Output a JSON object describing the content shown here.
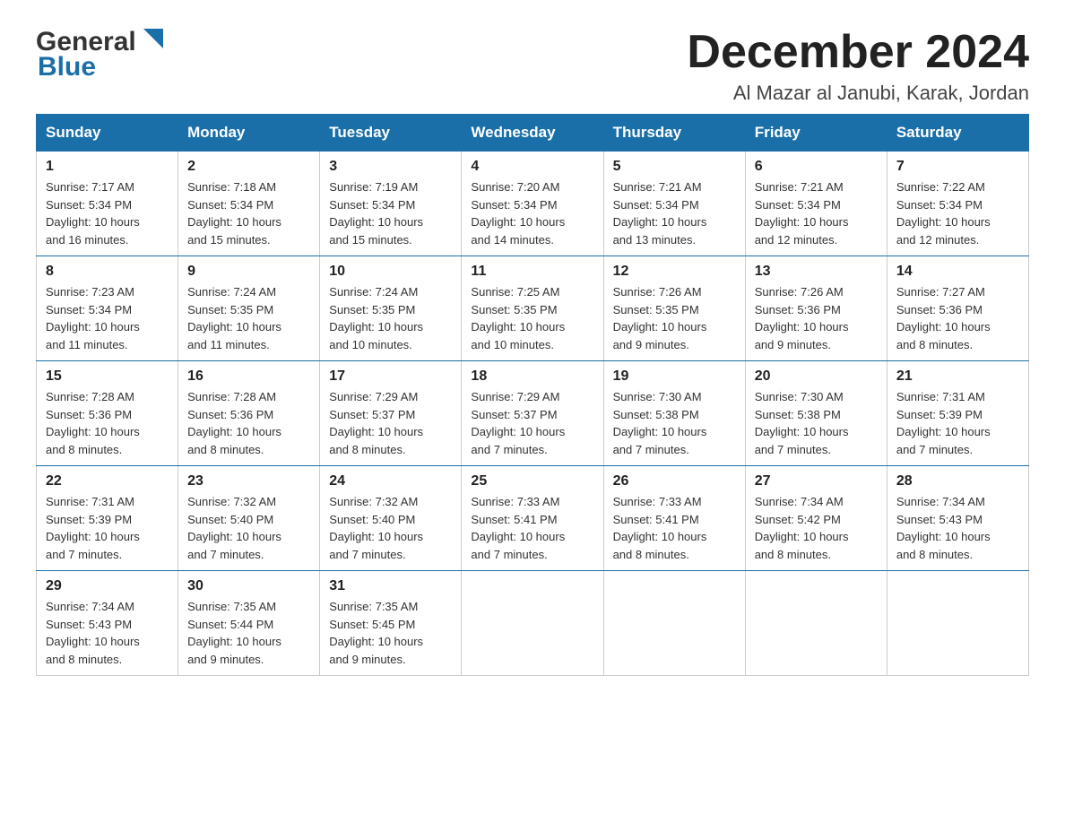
{
  "header": {
    "logo_general": "General",
    "logo_blue": "Blue",
    "month_title": "December 2024",
    "location": "Al Mazar al Janubi, Karak, Jordan"
  },
  "days_of_week": [
    "Sunday",
    "Monday",
    "Tuesday",
    "Wednesday",
    "Thursday",
    "Friday",
    "Saturday"
  ],
  "weeks": [
    [
      {
        "day": "1",
        "sunrise": "7:17 AM",
        "sunset": "5:34 PM",
        "daylight": "10 hours and 16 minutes."
      },
      {
        "day": "2",
        "sunrise": "7:18 AM",
        "sunset": "5:34 PM",
        "daylight": "10 hours and 15 minutes."
      },
      {
        "day": "3",
        "sunrise": "7:19 AM",
        "sunset": "5:34 PM",
        "daylight": "10 hours and 15 minutes."
      },
      {
        "day": "4",
        "sunrise": "7:20 AM",
        "sunset": "5:34 PM",
        "daylight": "10 hours and 14 minutes."
      },
      {
        "day": "5",
        "sunrise": "7:21 AM",
        "sunset": "5:34 PM",
        "daylight": "10 hours and 13 minutes."
      },
      {
        "day": "6",
        "sunrise": "7:21 AM",
        "sunset": "5:34 PM",
        "daylight": "10 hours and 12 minutes."
      },
      {
        "day": "7",
        "sunrise": "7:22 AM",
        "sunset": "5:34 PM",
        "daylight": "10 hours and 12 minutes."
      }
    ],
    [
      {
        "day": "8",
        "sunrise": "7:23 AM",
        "sunset": "5:34 PM",
        "daylight": "10 hours and 11 minutes."
      },
      {
        "day": "9",
        "sunrise": "7:24 AM",
        "sunset": "5:35 PM",
        "daylight": "10 hours and 11 minutes."
      },
      {
        "day": "10",
        "sunrise": "7:24 AM",
        "sunset": "5:35 PM",
        "daylight": "10 hours and 10 minutes."
      },
      {
        "day": "11",
        "sunrise": "7:25 AM",
        "sunset": "5:35 PM",
        "daylight": "10 hours and 10 minutes."
      },
      {
        "day": "12",
        "sunrise": "7:26 AM",
        "sunset": "5:35 PM",
        "daylight": "10 hours and 9 minutes."
      },
      {
        "day": "13",
        "sunrise": "7:26 AM",
        "sunset": "5:36 PM",
        "daylight": "10 hours and 9 minutes."
      },
      {
        "day": "14",
        "sunrise": "7:27 AM",
        "sunset": "5:36 PM",
        "daylight": "10 hours and 8 minutes."
      }
    ],
    [
      {
        "day": "15",
        "sunrise": "7:28 AM",
        "sunset": "5:36 PM",
        "daylight": "10 hours and 8 minutes."
      },
      {
        "day": "16",
        "sunrise": "7:28 AM",
        "sunset": "5:36 PM",
        "daylight": "10 hours and 8 minutes."
      },
      {
        "day": "17",
        "sunrise": "7:29 AM",
        "sunset": "5:37 PM",
        "daylight": "10 hours and 8 minutes."
      },
      {
        "day": "18",
        "sunrise": "7:29 AM",
        "sunset": "5:37 PM",
        "daylight": "10 hours and 7 minutes."
      },
      {
        "day": "19",
        "sunrise": "7:30 AM",
        "sunset": "5:38 PM",
        "daylight": "10 hours and 7 minutes."
      },
      {
        "day": "20",
        "sunrise": "7:30 AM",
        "sunset": "5:38 PM",
        "daylight": "10 hours and 7 minutes."
      },
      {
        "day": "21",
        "sunrise": "7:31 AM",
        "sunset": "5:39 PM",
        "daylight": "10 hours and 7 minutes."
      }
    ],
    [
      {
        "day": "22",
        "sunrise": "7:31 AM",
        "sunset": "5:39 PM",
        "daylight": "10 hours and 7 minutes."
      },
      {
        "day": "23",
        "sunrise": "7:32 AM",
        "sunset": "5:40 PM",
        "daylight": "10 hours and 7 minutes."
      },
      {
        "day": "24",
        "sunrise": "7:32 AM",
        "sunset": "5:40 PM",
        "daylight": "10 hours and 7 minutes."
      },
      {
        "day": "25",
        "sunrise": "7:33 AM",
        "sunset": "5:41 PM",
        "daylight": "10 hours and 7 minutes."
      },
      {
        "day": "26",
        "sunrise": "7:33 AM",
        "sunset": "5:41 PM",
        "daylight": "10 hours and 8 minutes."
      },
      {
        "day": "27",
        "sunrise": "7:34 AM",
        "sunset": "5:42 PM",
        "daylight": "10 hours and 8 minutes."
      },
      {
        "day": "28",
        "sunrise": "7:34 AM",
        "sunset": "5:43 PM",
        "daylight": "10 hours and 8 minutes."
      }
    ],
    [
      {
        "day": "29",
        "sunrise": "7:34 AM",
        "sunset": "5:43 PM",
        "daylight": "10 hours and 8 minutes."
      },
      {
        "day": "30",
        "sunrise": "7:35 AM",
        "sunset": "5:44 PM",
        "daylight": "10 hours and 9 minutes."
      },
      {
        "day": "31",
        "sunrise": "7:35 AM",
        "sunset": "5:45 PM",
        "daylight": "10 hours and 9 minutes."
      },
      null,
      null,
      null,
      null
    ]
  ],
  "labels": {
    "sunrise": "Sunrise:",
    "sunset": "Sunset:",
    "daylight": "Daylight:"
  }
}
